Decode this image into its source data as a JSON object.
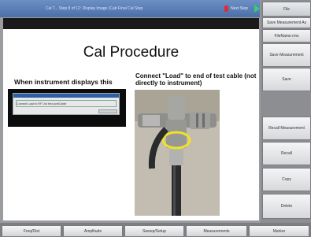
{
  "topbar": {
    "title": "Cal T... Step 8 of 12: Display Image  (Cab Final Cal Step",
    "next_label": "Next Step",
    "lock_icon": "lock-icon",
    "next_icon": "play-icon"
  },
  "content": {
    "heading": "Cal Procedure",
    "caption_left": "When instrument displays this",
    "caption_right": "Connect \"Load\" to end of test cable (not directly to instrument)",
    "inset_dialog_text": "Connect Load to RF Out test port/Cable"
  },
  "softkeys": [
    {
      "id": "file",
      "label": "File"
    },
    {
      "id": "save-measurement-as",
      "label": "Save Measurement As"
    },
    {
      "id": "filename",
      "label": "FileName.rms"
    },
    {
      "id": "save-measurement",
      "label": "Save Measurement"
    },
    {
      "id": "save",
      "label": "Save"
    },
    {
      "id": "recall-measurement",
      "label": "Recall Measurement"
    },
    {
      "id": "recall",
      "label": "Recall"
    },
    {
      "id": "copy",
      "label": "Copy"
    },
    {
      "id": "delete",
      "label": "Delete"
    }
  ],
  "bottom_tabs": [
    "Freq/Dist",
    "Amplitude",
    "Sweep/Setup",
    "Measurements",
    "Marker"
  ],
  "colors": {
    "topbar": "#5a7eb8",
    "accent_green": "#2fd36a",
    "lock_red": "#d8303a"
  }
}
